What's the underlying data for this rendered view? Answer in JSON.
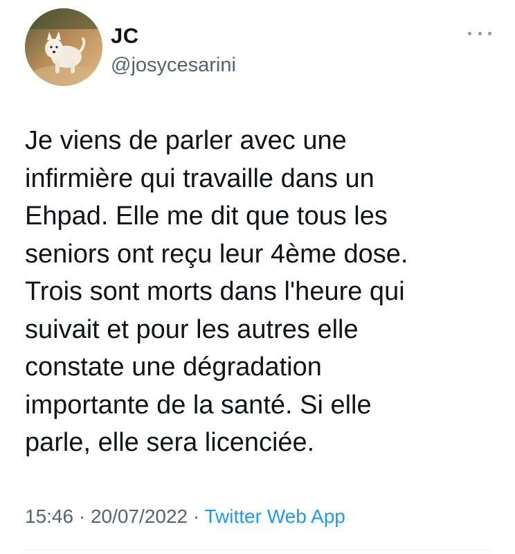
{
  "user": {
    "display_name": "JC",
    "handle": "@josycesarini",
    "avatar_icon": "westie-dog-photo-avatar"
  },
  "menu": {
    "more_icon": "more-horizontal-icon"
  },
  "tweet": {
    "text": "Je viens de parler avec une\ninfirmière qui travaille dans un\nEhpad. Elle me dit que tous les\nseniors ont reçu leur 4ème dose.\nTrois sont morts dans l'heure qui\nsuivait et pour les autres elle\nconstate une dégradation\nimportante de la santé. Si elle\nparle, elle sera licenciée."
  },
  "meta": {
    "time": "15:46",
    "date": "20/07/2022",
    "separator": " · ",
    "source": "Twitter Web App"
  },
  "colors": {
    "text": "#0f1419",
    "secondary": "#536471",
    "link": "#1d9bf0"
  }
}
